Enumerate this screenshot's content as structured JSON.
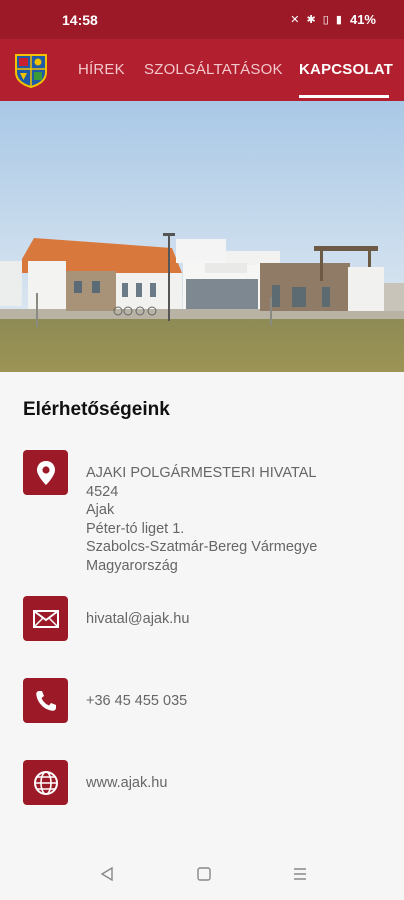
{
  "status": {
    "time": "14:58",
    "battery": "41%",
    "icons": "✕ ✱ ▯ ▮"
  },
  "appbar": {
    "tabs": [
      {
        "label": "HÍREK"
      },
      {
        "label": "SZOLGÁLTATÁSOK"
      },
      {
        "label": "KAPCSOLAT"
      }
    ],
    "active_tab": "KAPCSOLAT"
  },
  "contact": {
    "heading": "Elérhetőségeink",
    "address": [
      "AJAKI POLGÁRMESTERI HIVATAL",
      "4524",
      "Ajak",
      "Péter-tó liget 1.",
      "Szabolcs-Szatmár-Bereg Vármegye",
      "Magyarország"
    ],
    "email": "hivatal@ajak.hu",
    "phone": "+36 45 455 035",
    "website": "www.ajak.hu"
  },
  "colors": {
    "brand": "#b21f2e",
    "brand_dark": "#9c1a28"
  },
  "icons": [
    "location-pin-icon",
    "envelope-icon",
    "phone-icon",
    "globe-icon"
  ]
}
